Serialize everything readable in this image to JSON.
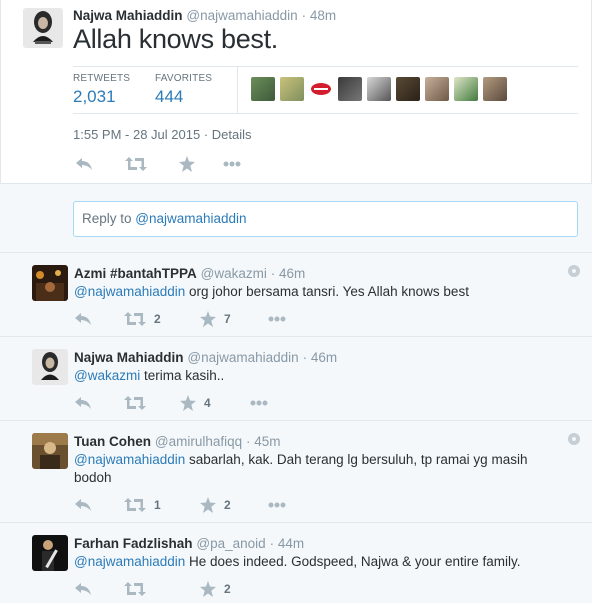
{
  "main_tweet": {
    "name": "Najwa Mahiaddin",
    "handle": "@najwamahiaddin",
    "time": "· 48m",
    "text": "Allah knows best.",
    "retweets_label": "RETWEETS",
    "retweets_value": "2,031",
    "favorites_label": "FAVORITES",
    "favorites_value": "444",
    "timestamp": "1:55 PM - 28 Jul 2015",
    "details_link": "Details",
    "actions": [
      "reply-icon",
      "retweet-icon",
      "favorite-icon",
      "more-icon"
    ]
  },
  "reply_box": {
    "prefix": "Reply to ",
    "mention": "@najwamahiaddin"
  },
  "replies": [
    {
      "name": "Azmi #bantahTPPA",
      "handle": "@wakazmi",
      "time": "· 46m",
      "mention": "@najwamahiaddin",
      "text": " org johor bersama tansri. Yes Allah knows best",
      "retweets": "2",
      "favorites": "7"
    },
    {
      "name": "Najwa Mahiaddin",
      "handle": "@najwamahiaddin",
      "time": "· 46m",
      "mention": "@wakazmi",
      "text": " terima kasih..",
      "retweets": "",
      "favorites": "4"
    },
    {
      "name": "Tuan Cohen",
      "handle": "@amirulhafiqq",
      "time": "· 45m",
      "mention": "@najwamahiaddin",
      "text": " sabarlah, kak. Dah terang lg bersuluh, tp ramai yg masih bodoh",
      "retweets": "1",
      "favorites": "2"
    },
    {
      "name": "Farhan Fadzlishah",
      "handle": "@pa_anoid",
      "time": "· 44m",
      "mention": "@najwamahiaddin",
      "text": " He does indeed. Godspeed, Najwa & your entire family.",
      "retweets": "",
      "favorites": "2"
    }
  ],
  "colors": {
    "link": "#2b7bb9",
    "muted": "#8899a6",
    "icon": "#aab8c2",
    "reply_bg": "#f5f8fa"
  }
}
